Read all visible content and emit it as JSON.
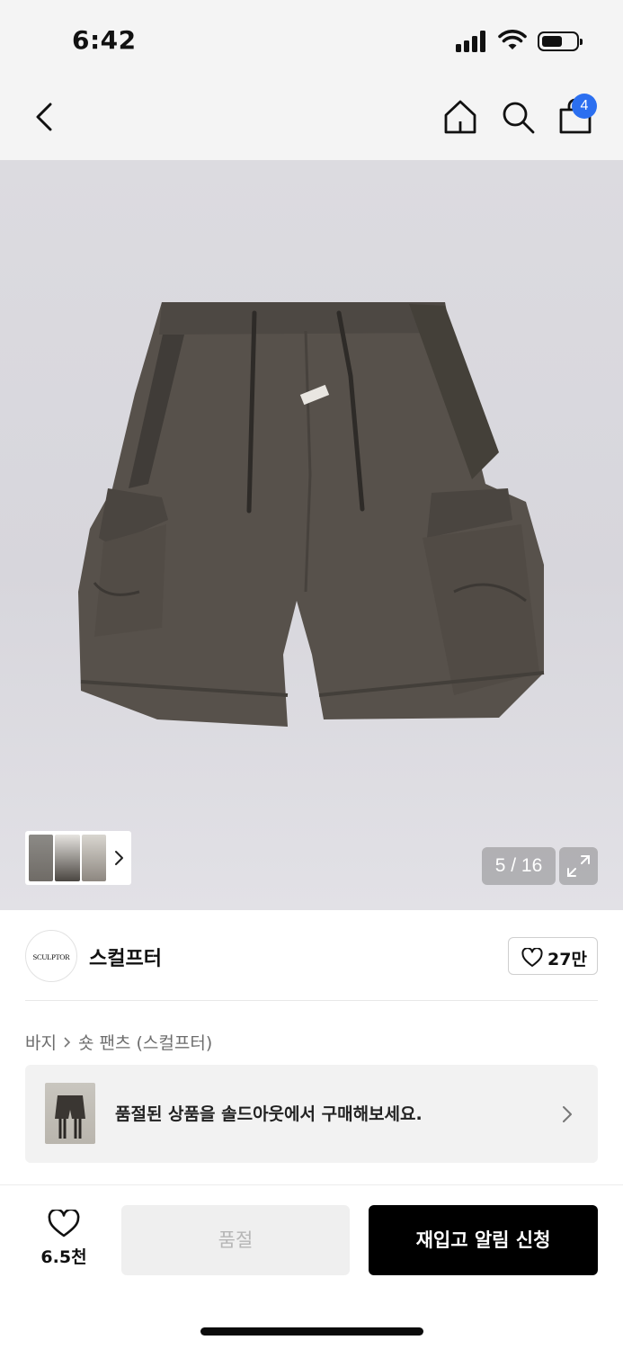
{
  "status_bar": {
    "time": "6:42"
  },
  "nav": {
    "cart_count": "4"
  },
  "gallery": {
    "counter": "5 / 16"
  },
  "brand": {
    "logo_text": "SCULPTOR",
    "name": "스컬프터",
    "like_count": "27만"
  },
  "breadcrumb": {
    "category": "바지",
    "sub": "숏 팬츠 (스컬프터)"
  },
  "banner": {
    "text": "품절된 상품을 솔드아웃에서 구매해보세요."
  },
  "bottom": {
    "wish_count": "6.5천",
    "soldout_label": "품절",
    "restock_label": "재입고 알림 신청"
  },
  "colors": {
    "badge": "#2b6ff0",
    "primary_button": "#000000",
    "disabled_button": "#efefef",
    "product": "#5a544e"
  },
  "icons": [
    "back-icon",
    "home-icon",
    "search-icon",
    "cart-icon",
    "chevron-right-icon",
    "expand-icon",
    "heart-icon"
  ]
}
